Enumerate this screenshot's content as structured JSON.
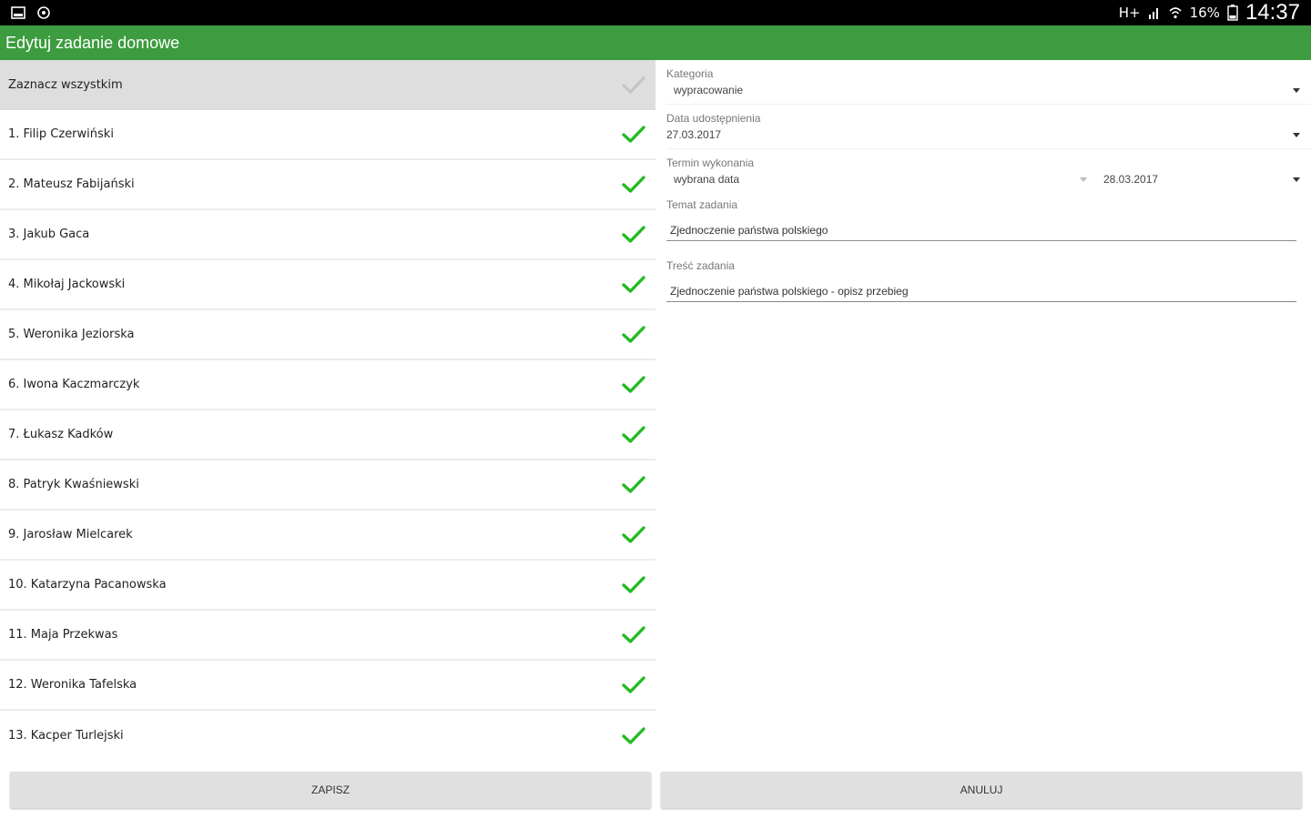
{
  "status_bar": {
    "signal": "H+",
    "battery": "16%",
    "time": "14:37",
    "icons": [
      "image-icon",
      "settings-notification-icon",
      "signal-icon",
      "wifi-icon",
      "battery-icon"
    ]
  },
  "app_bar": {
    "title": "Edytuj zadanie domowe"
  },
  "students": {
    "select_all_label": "Zaznacz wszystkim",
    "items": [
      "1. Filip Czerwiński",
      "2. Mateusz Fabijański",
      "3. Jakub Gaca",
      "4. Mikołaj Jackowski",
      "5. Weronika Jeziorska",
      "6. Iwona Kaczmarczyk",
      "7. Łukasz Kadków",
      "8. Patryk Kwaśniewski",
      "9. Jarosław Mielcarek",
      "10. Katarzyna Pacanowska",
      "11. Maja Przekwas",
      "12. Weronika Tafelska",
      "13. Kacper Turlejski"
    ],
    "check_color": "#22bb22",
    "select_all_check_color": "#c4c4c4"
  },
  "form": {
    "category": {
      "label": "Kategoria",
      "value": "wypracowanie"
    },
    "share_date": {
      "label": "Data udostępnienia",
      "value": "27.03.2017"
    },
    "due": {
      "label": "Termin wykonania",
      "mode_value": "wybrana data",
      "date_value": "28.03.2017"
    },
    "topic": {
      "label": "Temat zadania",
      "value": "Zjednoczenie państwa polskiego"
    },
    "content": {
      "label": "Treść zadania",
      "value": "Zjednoczenie państwa polskiego - opisz przebieg"
    }
  },
  "buttons": {
    "save": "ZAPISZ",
    "cancel": "ANULUJ"
  },
  "colors": {
    "app_bar": "#3d9c3f",
    "status_bar": "#000000",
    "button_bg": "#e0e0e0"
  }
}
